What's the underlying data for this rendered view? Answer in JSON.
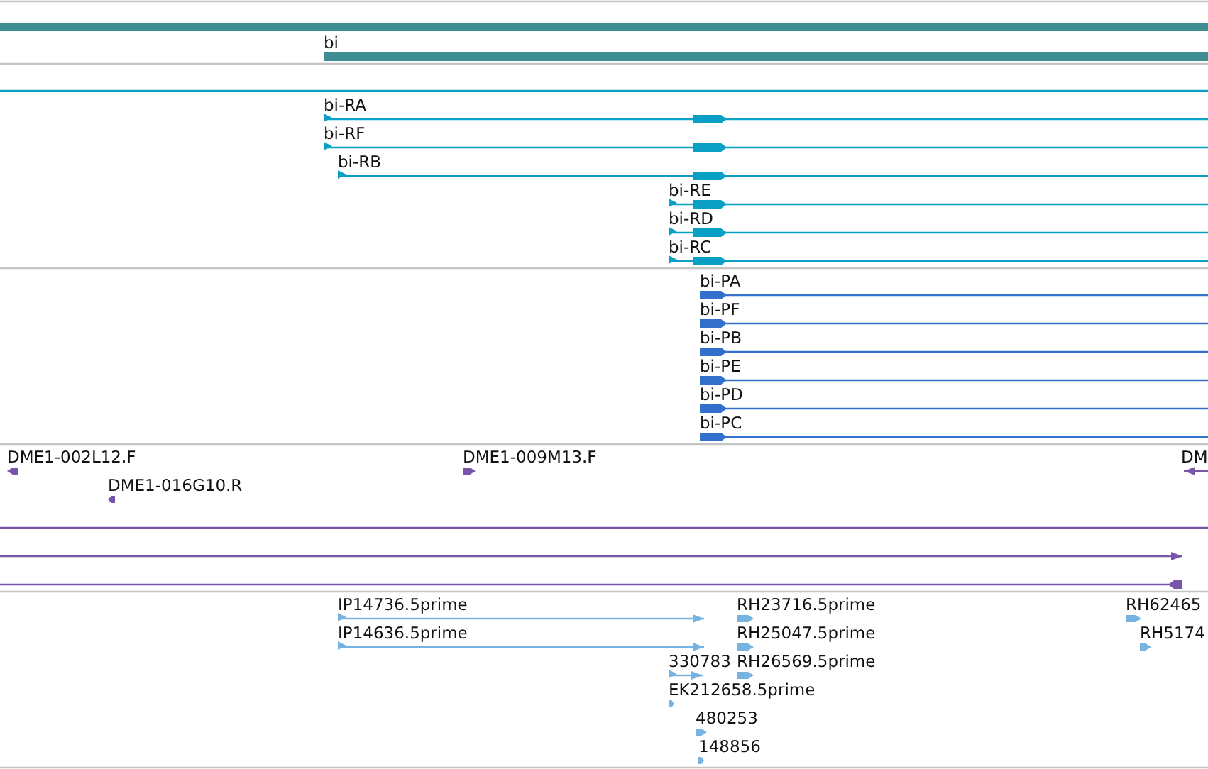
{
  "tracks": [
    {
      "kind": "gene",
      "features": [
        {
          "kind": "bar"
        },
        {
          "kind": "bar",
          "label": "bi"
        }
      ]
    },
    {
      "kind": "transcript",
      "features": [
        {
          "kind": "line"
        },
        {
          "kind": "line",
          "label": "bi-RA",
          "reverse": false
        },
        {
          "kind": "line",
          "label": "bi-RF",
          "reverse": false
        },
        {
          "kind": "line",
          "label": "bi-RB",
          "reverse": false
        },
        {
          "kind": "line",
          "label": "bi-RE",
          "reverse": false
        },
        {
          "kind": "line",
          "label": "bi-RD",
          "reverse": false
        },
        {
          "kind": "line",
          "label": "bi-RC",
          "reverse": false
        }
      ]
    },
    {
      "kind": "protein",
      "features": [
        {
          "kind": "line",
          "label": "bi-PA",
          "reverse": false
        },
        {
          "kind": "line",
          "label": "bi-PF",
          "reverse": false
        },
        {
          "kind": "line",
          "label": "bi-PB",
          "reverse": false
        },
        {
          "kind": "line",
          "label": "bi-PE",
          "reverse": false
        },
        {
          "kind": "line",
          "label": "bi-PD",
          "reverse": false
        },
        {
          "kind": "line",
          "label": "bi-PC",
          "reverse": false
        }
      ]
    },
    {
      "kind": "clone",
      "features": [
        {
          "kind": "mark",
          "label": "DME1-002L12.F",
          "reverse": true
        },
        {
          "kind": "mark",
          "label": "DME1-016G10.R",
          "reverse": true
        },
        {
          "kind": "mark",
          "label": "DME1-009M13.F",
          "reverse": false
        },
        {
          "kind": "line",
          "label": "DM",
          "reverse": true
        },
        {
          "kind": "line"
        },
        {
          "kind": "line",
          "reverse": false
        },
        {
          "kind": "line",
          "reverse": true
        }
      ]
    },
    {
      "kind": "est",
      "features": [
        {
          "kind": "line",
          "label": "IP14736.5prime",
          "reverse": false
        },
        {
          "kind": "line",
          "label": "IP14636.5prime",
          "reverse": false
        },
        {
          "kind": "line",
          "label": "330783",
          "reverse": false
        },
        {
          "kind": "mark",
          "label": "EK212658.5prime",
          "reverse": false
        },
        {
          "kind": "mark",
          "label": "480253",
          "reverse": false
        },
        {
          "kind": "mark",
          "label": "148856",
          "reverse": false
        },
        {
          "kind": "mark",
          "label": "RH23716.5prime",
          "reverse": false
        },
        {
          "kind": "mark",
          "label": "RH25047.5prime",
          "reverse": false
        },
        {
          "kind": "mark",
          "label": "RH26569.5prime",
          "reverse": false
        },
        {
          "kind": "mark",
          "label": "RH62465",
          "reverse": false
        },
        {
          "kind": "mark",
          "label": "RH5174",
          "reverse": false
        }
      ]
    }
  ]
}
